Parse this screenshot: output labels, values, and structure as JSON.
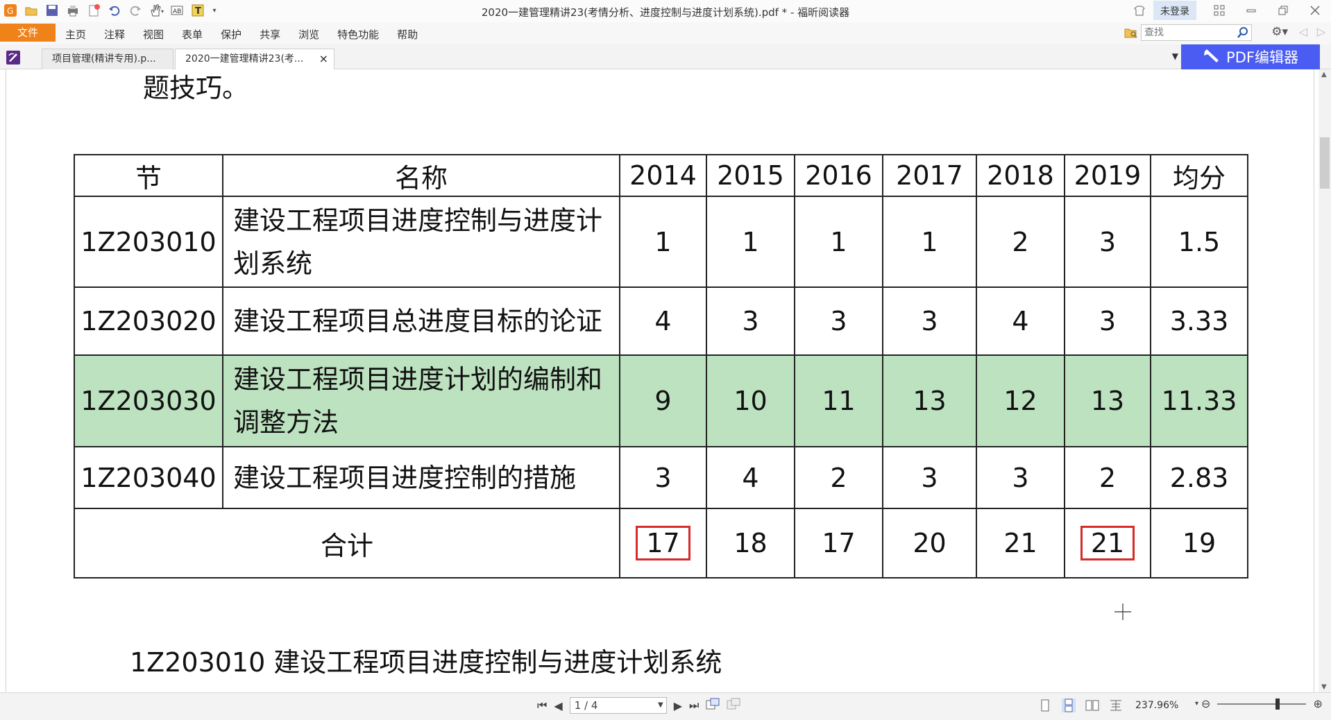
{
  "window": {
    "title": "2020一建管理精讲23(考情分析、进度控制与进度计划系统).pdf * - 福昕阅读器",
    "login_label": "未登录"
  },
  "menu": {
    "file_label": "文件",
    "items": [
      "主页",
      "注释",
      "视图",
      "表单",
      "保护",
      "共享",
      "浏览",
      "特色功能",
      "帮助"
    ],
    "search_placeholder": "查找"
  },
  "tabs": [
    {
      "label": "项目管理(精讲专用).p..."
    },
    {
      "label": "2020一建管理精讲23(考...",
      "close": "×"
    }
  ],
  "pdf_editor_label": "PDF编辑器",
  "document": {
    "heading_top": "题技巧。",
    "heading_bottom": "1Z203010  建设工程项目进度控制与进度计划系统",
    "table": {
      "headers": [
        "节",
        "名称",
        "2014",
        "2015",
        "2016",
        "2017",
        "2018",
        "2019",
        "均分"
      ],
      "rows": [
        {
          "code": "1Z203010",
          "name": "建设工程项目进度控制与进度计划系统",
          "values": [
            "1",
            "1",
            "1",
            "1",
            "2",
            "3",
            "1.5"
          ]
        },
        {
          "code": "1Z203020",
          "name": "建设工程项目总进度目标的论证",
          "values": [
            "4",
            "3",
            "3",
            "3",
            "4",
            "3",
            "3.33"
          ]
        },
        {
          "code": "1Z203030",
          "name": "建设工程项目进度计划的编制和调整方法",
          "values": [
            "9",
            "10",
            "11",
            "13",
            "12",
            "13",
            "11.33"
          ],
          "highlight_color": "#bde2c0"
        },
        {
          "code": "1Z203040",
          "name": "建设工程项目进度控制的措施",
          "values": [
            "3",
            "4",
            "2",
            "3",
            "3",
            "2",
            "2.83"
          ]
        }
      ],
      "total_label": "合计",
      "totals": [
        "17",
        "18",
        "17",
        "20",
        "21",
        "21",
        "19"
      ],
      "boxed_color": "#d62b2b"
    }
  },
  "status": {
    "page": "1 / 4",
    "zoom": "237.96%"
  },
  "colors": {
    "file_menu": "#f0821a",
    "pdf_editor": "#4a5cf2",
    "login_bg": "#dbe7f7"
  }
}
